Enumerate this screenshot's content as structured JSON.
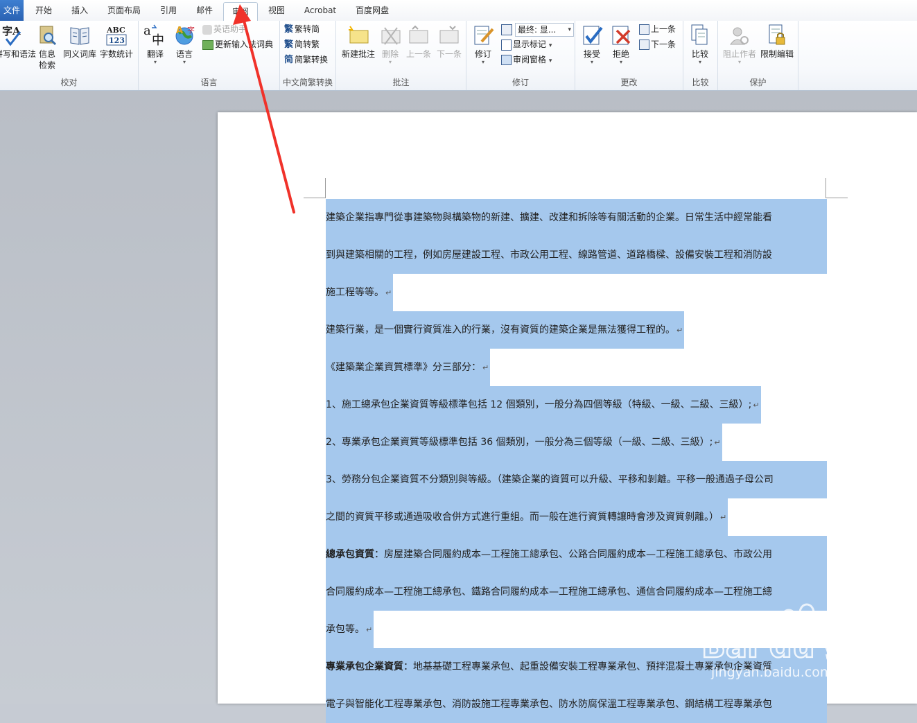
{
  "tabs": {
    "file": "文件",
    "home": "开始",
    "insert": "插入",
    "layout": "页面布局",
    "references": "引用",
    "mailings": "邮件",
    "review": "审阅",
    "view": "视图",
    "acrobat": "Acrobat",
    "baidu": "百度网盘"
  },
  "groups": {
    "proofing": {
      "label": "校对",
      "spelling": "拼写和语法",
      "research_line1": "信息",
      "research_line2": "检索",
      "thesaurus": "同义词库",
      "word_count": "字数统计"
    },
    "language": {
      "label": "语言",
      "translate": "翻译",
      "language": "语言",
      "english_assistant": "英语助手",
      "update_ime": "更新输入法词典"
    },
    "chinese_conversion": {
      "label": "中文简繁转换",
      "to_simplified": "繁转简",
      "to_traditional": "简转繁",
      "convert": "简繁转换"
    },
    "comments": {
      "label": "批注",
      "new": "新建批注",
      "delete": "删除",
      "previous": "上一条",
      "next": "下一条"
    },
    "tracking": {
      "label": "修订",
      "track_changes": "修订",
      "display_value": "最终: 显...",
      "show_markup": "显示标记",
      "reviewing_pane": "审阅窗格"
    },
    "changes": {
      "label": "更改",
      "accept": "接受",
      "reject": "拒绝",
      "previous": "上一条",
      "next": "下一条"
    },
    "compare": {
      "label": "比较",
      "compare": "比较"
    },
    "protect": {
      "label": "保护",
      "block_authors": "阻止作者",
      "restrict_editing": "限制编辑"
    }
  },
  "document": {
    "lines": [
      {
        "text": "建築企業指專門從事建築物與構築物的新建、擴建、改建和拆除等有關活動的企業。日常生活中經常能看",
        "mark": false
      },
      {
        "text": "到與建築相關的工程，例如房屋建設工程、市政公用工程、線路管道、道路橋樑、設備安裝工程和消防設",
        "mark": false
      },
      {
        "text": "施工程等等。",
        "mark": true
      },
      {
        "text": "建築行業，是一個實行資質准入的行業，沒有資質的建築企業是無法獲得工程的。",
        "mark": true
      },
      {
        "text": "《建築業企業資質標準》分三部分：",
        "mark": true
      },
      {
        "text": "1、施工總承包企業資質等級標準包括 12 個類別，一般分為四個等級（特級、一級、二級、三級）;",
        "mark": true
      },
      {
        "text": "2、專業承包企業資質等級標準包括 36 個類別，一般分為三個等級（一級、二級、三級）;",
        "mark": true
      },
      {
        "text": "3、勞務分包企業資質不分類別與等級。（建築企業的資質可以升級、平移和剝離。平移一般通過子母公司",
        "mark": false
      },
      {
        "text": "之間的資質平移或通過吸收合併方式進行重組。而一般在進行資質轉讓時會涉及資質剝離。）",
        "mark": true
      },
      {
        "bold": "總承包資質",
        "text": "：房屋建築合同履約成本—工程施工總承包、公路合同履約成本—工程施工總承包、市政公用",
        "mark": false
      },
      {
        "text": "合同履約成本—工程施工總承包、鐵路合同履約成本—工程施工總承包、通信合同履約成本—工程施工總",
        "mark": false
      },
      {
        "text": "承包等。",
        "mark": true
      },
      {
        "bold": "專業承包企業資質",
        "text": "：地基基礎工程專業承包、起重設備安裝工程專業承包、預拌混凝土專業承包企業資質",
        "mark": false
      },
      {
        "text": "電子與智能化工程專業承包、消防設施工程專業承包、防水防腐保溫工程專業承包、鋼結構工程專業承包",
        "mark": false
      }
    ],
    "paragraph_mark": "↵"
  },
  "watermark": {
    "brand": "Bai du 经验",
    "url": "jingyan.baidu.com"
  },
  "colors": {
    "selection": "#a5c8ed",
    "annotation_arrow": "#f0322a",
    "file_tab": "#2f6bbd"
  }
}
